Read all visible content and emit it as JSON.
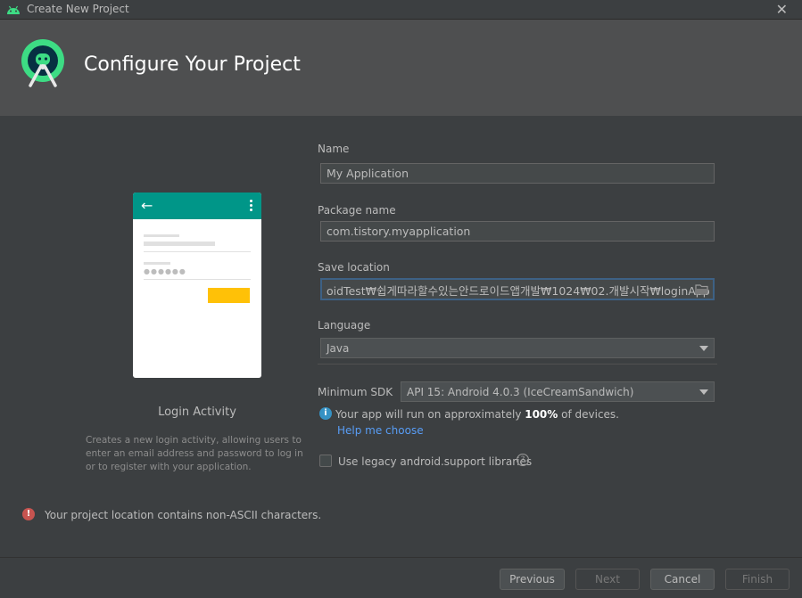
{
  "window": {
    "title": "Create New Project",
    "close_glyph": "✕"
  },
  "header": {
    "title": "Configure Your Project"
  },
  "preview": {
    "activity_name": "Login Activity",
    "description": "Creates a new login activity, allowing users to enter an email address and password to log in or to register with your application.",
    "back_glyph": "←",
    "password_dots": "●●●●●●",
    "toolbar_color": "#009688",
    "button_color": "#ffc107"
  },
  "form": {
    "name": {
      "label": "Name",
      "value": "My Application"
    },
    "package": {
      "label": "Package name",
      "value": "com.tistory.myapplication"
    },
    "save_location": {
      "label": "Save location",
      "value": "oidTest₩쉽게따라할수있는안드로이드앱개발₩1024₩02.개발시작₩loginApp"
    },
    "language": {
      "label": "Language",
      "value": "Java"
    },
    "min_sdk": {
      "label": "Minimum SDK",
      "value": "API 15: Android 4.0.3 (IceCreamSandwich)"
    },
    "info": {
      "prefix": "Your app will run on approximately ",
      "percent": "100%",
      "suffix": " of devices."
    },
    "help_link": "Help me choose",
    "legacy_checkbox": {
      "label": "Use legacy android.support libraries",
      "checked": false
    }
  },
  "error": {
    "message": "Your project location contains non-ASCII characters.",
    "color": "#c75450"
  },
  "buttons": {
    "previous": "Previous",
    "next": "Next",
    "cancel": "Cancel",
    "finish": "Finish"
  },
  "icons": {
    "app": "android-icon",
    "logo": "android-studio-logo",
    "folder": "folder-icon",
    "info": "info-icon",
    "help": "question-icon",
    "error": "error-icon"
  }
}
